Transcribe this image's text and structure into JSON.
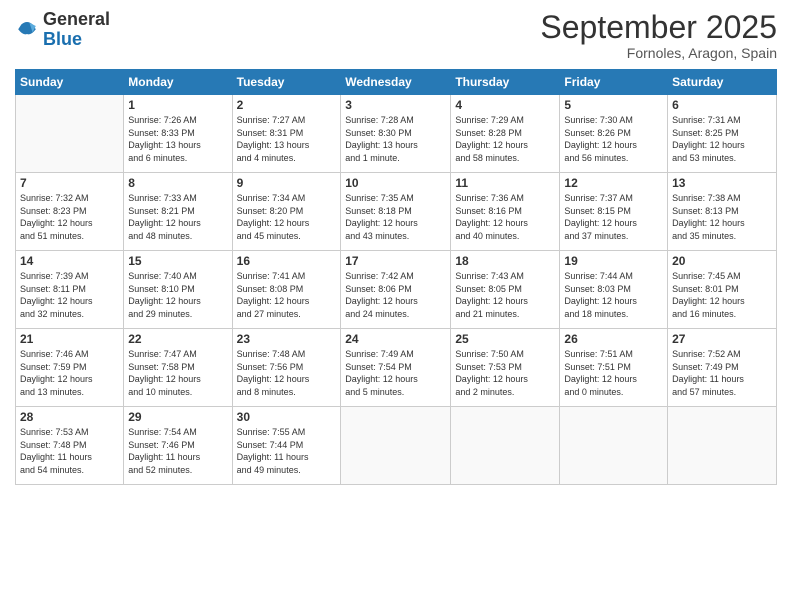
{
  "logo": {
    "general": "General",
    "blue": "Blue"
  },
  "header": {
    "month": "September 2025",
    "location": "Fornoles, Aragon, Spain"
  },
  "days_of_week": [
    "Sunday",
    "Monday",
    "Tuesday",
    "Wednesday",
    "Thursday",
    "Friday",
    "Saturday"
  ],
  "weeks": [
    [
      {
        "day": "",
        "info": ""
      },
      {
        "day": "1",
        "info": "Sunrise: 7:26 AM\nSunset: 8:33 PM\nDaylight: 13 hours\nand 6 minutes."
      },
      {
        "day": "2",
        "info": "Sunrise: 7:27 AM\nSunset: 8:31 PM\nDaylight: 13 hours\nand 4 minutes."
      },
      {
        "day": "3",
        "info": "Sunrise: 7:28 AM\nSunset: 8:30 PM\nDaylight: 13 hours\nand 1 minute."
      },
      {
        "day": "4",
        "info": "Sunrise: 7:29 AM\nSunset: 8:28 PM\nDaylight: 12 hours\nand 58 minutes."
      },
      {
        "day": "5",
        "info": "Sunrise: 7:30 AM\nSunset: 8:26 PM\nDaylight: 12 hours\nand 56 minutes."
      },
      {
        "day": "6",
        "info": "Sunrise: 7:31 AM\nSunset: 8:25 PM\nDaylight: 12 hours\nand 53 minutes."
      }
    ],
    [
      {
        "day": "7",
        "info": "Sunrise: 7:32 AM\nSunset: 8:23 PM\nDaylight: 12 hours\nand 51 minutes."
      },
      {
        "day": "8",
        "info": "Sunrise: 7:33 AM\nSunset: 8:21 PM\nDaylight: 12 hours\nand 48 minutes."
      },
      {
        "day": "9",
        "info": "Sunrise: 7:34 AM\nSunset: 8:20 PM\nDaylight: 12 hours\nand 45 minutes."
      },
      {
        "day": "10",
        "info": "Sunrise: 7:35 AM\nSunset: 8:18 PM\nDaylight: 12 hours\nand 43 minutes."
      },
      {
        "day": "11",
        "info": "Sunrise: 7:36 AM\nSunset: 8:16 PM\nDaylight: 12 hours\nand 40 minutes."
      },
      {
        "day": "12",
        "info": "Sunrise: 7:37 AM\nSunset: 8:15 PM\nDaylight: 12 hours\nand 37 minutes."
      },
      {
        "day": "13",
        "info": "Sunrise: 7:38 AM\nSunset: 8:13 PM\nDaylight: 12 hours\nand 35 minutes."
      }
    ],
    [
      {
        "day": "14",
        "info": "Sunrise: 7:39 AM\nSunset: 8:11 PM\nDaylight: 12 hours\nand 32 minutes."
      },
      {
        "day": "15",
        "info": "Sunrise: 7:40 AM\nSunset: 8:10 PM\nDaylight: 12 hours\nand 29 minutes."
      },
      {
        "day": "16",
        "info": "Sunrise: 7:41 AM\nSunset: 8:08 PM\nDaylight: 12 hours\nand 27 minutes."
      },
      {
        "day": "17",
        "info": "Sunrise: 7:42 AM\nSunset: 8:06 PM\nDaylight: 12 hours\nand 24 minutes."
      },
      {
        "day": "18",
        "info": "Sunrise: 7:43 AM\nSunset: 8:05 PM\nDaylight: 12 hours\nand 21 minutes."
      },
      {
        "day": "19",
        "info": "Sunrise: 7:44 AM\nSunset: 8:03 PM\nDaylight: 12 hours\nand 18 minutes."
      },
      {
        "day": "20",
        "info": "Sunrise: 7:45 AM\nSunset: 8:01 PM\nDaylight: 12 hours\nand 16 minutes."
      }
    ],
    [
      {
        "day": "21",
        "info": "Sunrise: 7:46 AM\nSunset: 7:59 PM\nDaylight: 12 hours\nand 13 minutes."
      },
      {
        "day": "22",
        "info": "Sunrise: 7:47 AM\nSunset: 7:58 PM\nDaylight: 12 hours\nand 10 minutes."
      },
      {
        "day": "23",
        "info": "Sunrise: 7:48 AM\nSunset: 7:56 PM\nDaylight: 12 hours\nand 8 minutes."
      },
      {
        "day": "24",
        "info": "Sunrise: 7:49 AM\nSunset: 7:54 PM\nDaylight: 12 hours\nand 5 minutes."
      },
      {
        "day": "25",
        "info": "Sunrise: 7:50 AM\nSunset: 7:53 PM\nDaylight: 12 hours\nand 2 minutes."
      },
      {
        "day": "26",
        "info": "Sunrise: 7:51 AM\nSunset: 7:51 PM\nDaylight: 12 hours\nand 0 minutes."
      },
      {
        "day": "27",
        "info": "Sunrise: 7:52 AM\nSunset: 7:49 PM\nDaylight: 11 hours\nand 57 minutes."
      }
    ],
    [
      {
        "day": "28",
        "info": "Sunrise: 7:53 AM\nSunset: 7:48 PM\nDaylight: 11 hours\nand 54 minutes."
      },
      {
        "day": "29",
        "info": "Sunrise: 7:54 AM\nSunset: 7:46 PM\nDaylight: 11 hours\nand 52 minutes."
      },
      {
        "day": "30",
        "info": "Sunrise: 7:55 AM\nSunset: 7:44 PM\nDaylight: 11 hours\nand 49 minutes."
      },
      {
        "day": "",
        "info": ""
      },
      {
        "day": "",
        "info": ""
      },
      {
        "day": "",
        "info": ""
      },
      {
        "day": "",
        "info": ""
      }
    ]
  ]
}
